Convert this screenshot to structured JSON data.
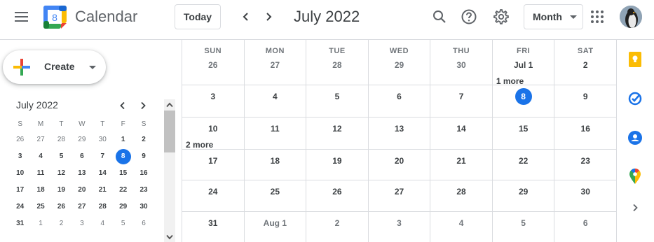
{
  "header": {
    "app_title": "Calendar",
    "logo_day": "8",
    "today_label": "Today",
    "period_title": "July 2022",
    "view_label": "Month",
    "icons": [
      "menu-icon",
      "search-icon",
      "help-icon",
      "settings-icon",
      "apps-grid-icon"
    ]
  },
  "sidebar": {
    "create_label": "Create",
    "mini_calendar": {
      "title": "July 2022",
      "dow": [
        "S",
        "M",
        "T",
        "W",
        "T",
        "F",
        "S"
      ],
      "weeks": [
        [
          {
            "d": "26",
            "t": "other"
          },
          {
            "d": "27",
            "t": "other"
          },
          {
            "d": "28",
            "t": "other"
          },
          {
            "d": "29",
            "t": "other"
          },
          {
            "d": "30",
            "t": "other"
          },
          {
            "d": "1",
            "t": "bold"
          },
          {
            "d": "2",
            "t": "bold"
          }
        ],
        [
          {
            "d": "3",
            "t": "bold"
          },
          {
            "d": "4",
            "t": "bold"
          },
          {
            "d": "5",
            "t": "bold"
          },
          {
            "d": "6",
            "t": "bold"
          },
          {
            "d": "7",
            "t": "bold"
          },
          {
            "d": "8",
            "t": "today"
          },
          {
            "d": "9",
            "t": "bold"
          }
        ],
        [
          {
            "d": "10",
            "t": "bold"
          },
          {
            "d": "11",
            "t": "bold"
          },
          {
            "d": "12",
            "t": "bold"
          },
          {
            "d": "13",
            "t": "bold"
          },
          {
            "d": "14",
            "t": "bold"
          },
          {
            "d": "15",
            "t": "bold"
          },
          {
            "d": "16",
            "t": "bold"
          }
        ],
        [
          {
            "d": "17",
            "t": "bold"
          },
          {
            "d": "18",
            "t": "bold"
          },
          {
            "d": "19",
            "t": "bold"
          },
          {
            "d": "20",
            "t": "bold"
          },
          {
            "d": "21",
            "t": "bold"
          },
          {
            "d": "22",
            "t": "bold"
          },
          {
            "d": "23",
            "t": "bold"
          }
        ],
        [
          {
            "d": "24",
            "t": "bold"
          },
          {
            "d": "25",
            "t": "bold"
          },
          {
            "d": "26",
            "t": "bold"
          },
          {
            "d": "27",
            "t": "bold"
          },
          {
            "d": "28",
            "t": "bold"
          },
          {
            "d": "29",
            "t": "bold"
          },
          {
            "d": "30",
            "t": "bold"
          }
        ],
        [
          {
            "d": "31",
            "t": "bold"
          },
          {
            "d": "1",
            "t": "other"
          },
          {
            "d": "2",
            "t": "other"
          },
          {
            "d": "3",
            "t": "other"
          },
          {
            "d": "4",
            "t": "other"
          },
          {
            "d": "5",
            "t": "other"
          },
          {
            "d": "6",
            "t": "other"
          }
        ]
      ]
    }
  },
  "month_view": {
    "dow": [
      "SUN",
      "MON",
      "TUE",
      "WED",
      "THU",
      "FRI",
      "SAT"
    ],
    "weeks": [
      [
        {
          "d": "26",
          "t": "other"
        },
        {
          "d": "27",
          "t": "other"
        },
        {
          "d": "28",
          "t": "other"
        },
        {
          "d": "29",
          "t": "other"
        },
        {
          "d": "30",
          "t": "other"
        },
        {
          "d": "Jul 1",
          "t": "cur",
          "more": "1 more"
        },
        {
          "d": "2",
          "t": "cur"
        }
      ],
      [
        {
          "d": "3",
          "t": "cur"
        },
        {
          "d": "4",
          "t": "cur"
        },
        {
          "d": "5",
          "t": "cur"
        },
        {
          "d": "6",
          "t": "cur"
        },
        {
          "d": "7",
          "t": "cur"
        },
        {
          "d": "8",
          "t": "today"
        },
        {
          "d": "9",
          "t": "cur"
        }
      ],
      [
        {
          "d": "10",
          "t": "cur",
          "more": "2 more"
        },
        {
          "d": "11",
          "t": "cur"
        },
        {
          "d": "12",
          "t": "cur"
        },
        {
          "d": "13",
          "t": "cur"
        },
        {
          "d": "14",
          "t": "cur"
        },
        {
          "d": "15",
          "t": "cur"
        },
        {
          "d": "16",
          "t": "cur"
        }
      ],
      [
        {
          "d": "17",
          "t": "cur"
        },
        {
          "d": "18",
          "t": "cur"
        },
        {
          "d": "19",
          "t": "cur"
        },
        {
          "d": "20",
          "t": "cur"
        },
        {
          "d": "21",
          "t": "cur"
        },
        {
          "d": "22",
          "t": "cur"
        },
        {
          "d": "23",
          "t": "cur"
        }
      ],
      [
        {
          "d": "24",
          "t": "cur"
        },
        {
          "d": "25",
          "t": "cur"
        },
        {
          "d": "26",
          "t": "cur"
        },
        {
          "d": "27",
          "t": "cur"
        },
        {
          "d": "28",
          "t": "cur"
        },
        {
          "d": "29",
          "t": "cur"
        },
        {
          "d": "30",
          "t": "cur"
        }
      ],
      [
        {
          "d": "31",
          "t": "cur"
        },
        {
          "d": "Aug 1",
          "t": "other"
        },
        {
          "d": "2",
          "t": "other"
        },
        {
          "d": "3",
          "t": "other"
        },
        {
          "d": "4",
          "t": "other"
        },
        {
          "d": "5",
          "t": "other"
        },
        {
          "d": "6",
          "t": "other"
        }
      ]
    ]
  },
  "side_rail": {
    "icons": [
      "keep-icon",
      "tasks-icon",
      "contacts-icon",
      "maps-icon",
      "expand-panel-icon"
    ]
  },
  "colors": {
    "accent": "#1a73e8",
    "border": "#dadce0",
    "text": "#3c4043",
    "muted": "#70757a"
  }
}
